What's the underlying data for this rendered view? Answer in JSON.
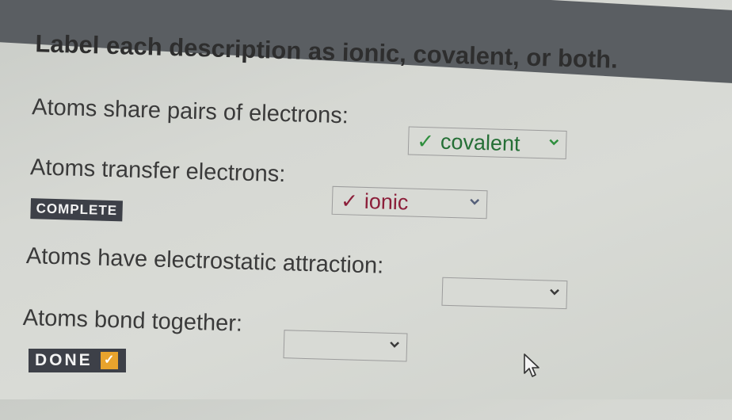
{
  "title": "Label each description as ionic, covalent, or both.",
  "items": [
    {
      "prompt": "Atoms share pairs of electrons:",
      "answer": "covalent",
      "status": "correct"
    },
    {
      "prompt": "Atoms transfer electrons:",
      "answer": "ionic",
      "status": "correct"
    },
    {
      "prompt": "Atoms have electrostatic attraction:",
      "answer": "",
      "status": "unanswered"
    },
    {
      "prompt": "Atoms bond together:",
      "answer": "",
      "status": "unanswered"
    }
  ],
  "badges": {
    "complete": "COMPLETE",
    "done": "DONE"
  },
  "icons": {
    "check": "check-icon",
    "chevron": "chevron-down-icon",
    "cursor": "mouse-pointer-icon"
  },
  "colors": {
    "correct": "#2f8f3e",
    "answer_green": "#256f36",
    "answer_red": "#8c1f3a",
    "badge_bg": "#3d4048",
    "done_check": "#e8a32d"
  }
}
